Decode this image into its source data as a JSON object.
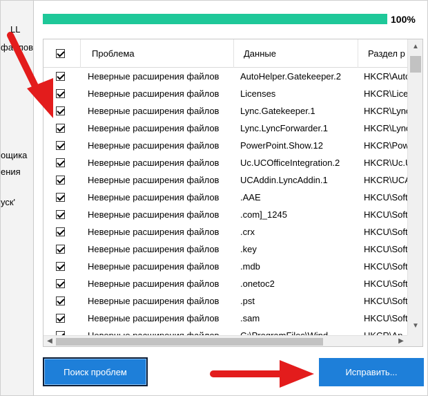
{
  "left_panel": {
    "fragments": [
      "LL",
      "файлов",
      "ощика",
      "ения",
      "уск'"
    ]
  },
  "progress": {
    "value": 1.0,
    "label": "100%",
    "color": "#1ec899"
  },
  "table": {
    "columns": [
      "Проблема",
      "Данные",
      "Раздел р"
    ],
    "rows": [
      {
        "checked": true,
        "problem": "Неверные расширения файлов",
        "data": "AutoHelper.Gatekeeper.2",
        "section": "HKCR\\Auto"
      },
      {
        "checked": true,
        "problem": "Неверные расширения файлов",
        "data": "Licenses",
        "section": "HKCR\\Licen"
      },
      {
        "checked": true,
        "problem": "Неверные расширения файлов",
        "data": "Lync.Gatekeeper.1",
        "section": "HKCR\\Lync"
      },
      {
        "checked": true,
        "problem": "Неверные расширения файлов",
        "data": "Lync.LyncForwarder.1",
        "section": "HKCR\\Lync"
      },
      {
        "checked": true,
        "problem": "Неверные расширения файлов",
        "data": "PowerPoint.Show.12",
        "section": "HKCR\\Pow"
      },
      {
        "checked": true,
        "problem": "Неверные расширения файлов",
        "data": "Uc.UCOfficeIntegration.2",
        "section": "HKCR\\Uc.U"
      },
      {
        "checked": true,
        "problem": "Неверные расширения файлов",
        "data": "UCAddin.LyncAddin.1",
        "section": "HKCR\\UCA"
      },
      {
        "checked": true,
        "problem": "Неверные расширения файлов",
        "data": ".AAE",
        "section": "HKCU\\Soft"
      },
      {
        "checked": true,
        "problem": "Неверные расширения файлов",
        "data": ".com]_1245",
        "section": "HKCU\\Soft"
      },
      {
        "checked": true,
        "problem": "Неверные расширения файлов",
        "data": ".crx",
        "section": "HKCU\\Soft"
      },
      {
        "checked": true,
        "problem": "Неверные расширения файлов",
        "data": ".key",
        "section": "HKCU\\Soft"
      },
      {
        "checked": true,
        "problem": "Неверные расширения файлов",
        "data": ".mdb",
        "section": "HKCU\\Soft"
      },
      {
        "checked": true,
        "problem": "Неверные расширения файлов",
        "data": ".onetoc2",
        "section": "HKCU\\Soft"
      },
      {
        "checked": true,
        "problem": "Неверные расширения файлов",
        "data": ".pst",
        "section": "HKCU\\Soft"
      },
      {
        "checked": true,
        "problem": "Неверные расширения файлов",
        "data": ".sam",
        "section": "HKCU\\Soft"
      },
      {
        "checked": true,
        "problem": "Неверные расширения файлов",
        "data": "C:\\ProgramFiles\\Wind",
        "section": "HKCR\\Ap"
      }
    ]
  },
  "buttons": {
    "scan_label": "Поиск проблем",
    "fix_label": "Исправить...",
    "color": "#1e7fd9"
  },
  "annotations": {
    "arrow_color": "#e31c1c"
  },
  "icons": {
    "scroll_up": "▲",
    "scroll_down": "▼",
    "scroll_left": "◀",
    "scroll_right": "▶"
  }
}
